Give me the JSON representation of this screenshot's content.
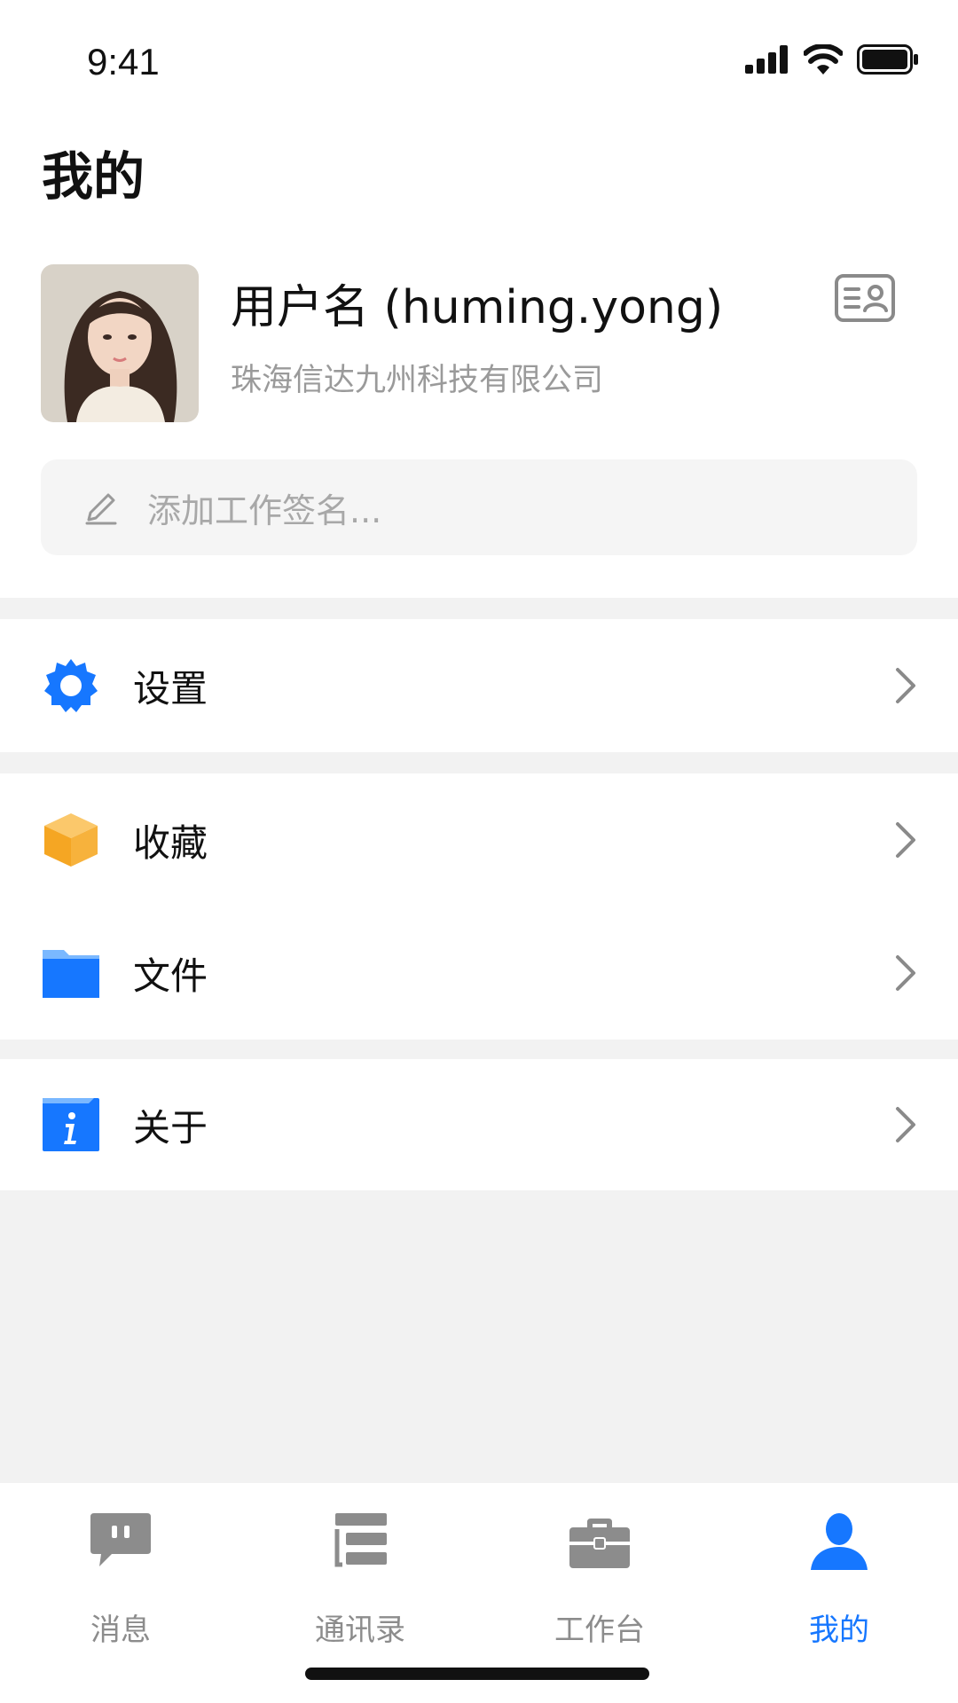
{
  "status_bar": {
    "time": "9:41"
  },
  "header": {
    "title": "我的"
  },
  "profile": {
    "username": "用户名 (huming.yong)",
    "company": "珠海信达九州科技有限公司",
    "avatar_icon": "avatar-photo",
    "card_icon": "contact-card-icon"
  },
  "signature": {
    "placeholder": "添加工作签名..."
  },
  "menu": {
    "settings": {
      "label": "设置",
      "icon": "gear-icon",
      "color": "#1677ff"
    },
    "favorites": {
      "label": "收藏",
      "icon": "box-icon",
      "color": "#f5a623"
    },
    "files": {
      "label": "文件",
      "icon": "folder-icon",
      "color": "#1677ff"
    },
    "about": {
      "label": "关于",
      "icon": "info-icon",
      "color": "#1677ff"
    }
  },
  "tabbar": {
    "tabs": [
      {
        "label": "消息",
        "icon": "chat-bubble-icon"
      },
      {
        "label": "通讯录",
        "icon": "contacts-icon"
      },
      {
        "label": "工作台",
        "icon": "briefcase-icon"
      },
      {
        "label": "我的",
        "icon": "person-icon"
      }
    ],
    "active_index": 3,
    "active_color": "#1677ff",
    "inactive_color": "#8c8c8c"
  }
}
